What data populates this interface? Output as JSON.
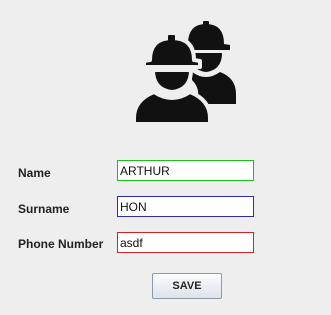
{
  "form": {
    "icon": "workers-hardhat-icon",
    "fields": [
      {
        "label": "Name",
        "value": "ARTHUR",
        "border_color": "#18c218"
      },
      {
        "label": "Surname",
        "value": "HON",
        "border_color": "#2b2bb4"
      },
      {
        "label": "Phone Number",
        "value": "asdf",
        "border_color": "#d4212b"
      }
    ],
    "save_label": "SAVE"
  },
  "colors": {
    "background": "#eeeeee",
    "icon": "#111111"
  }
}
